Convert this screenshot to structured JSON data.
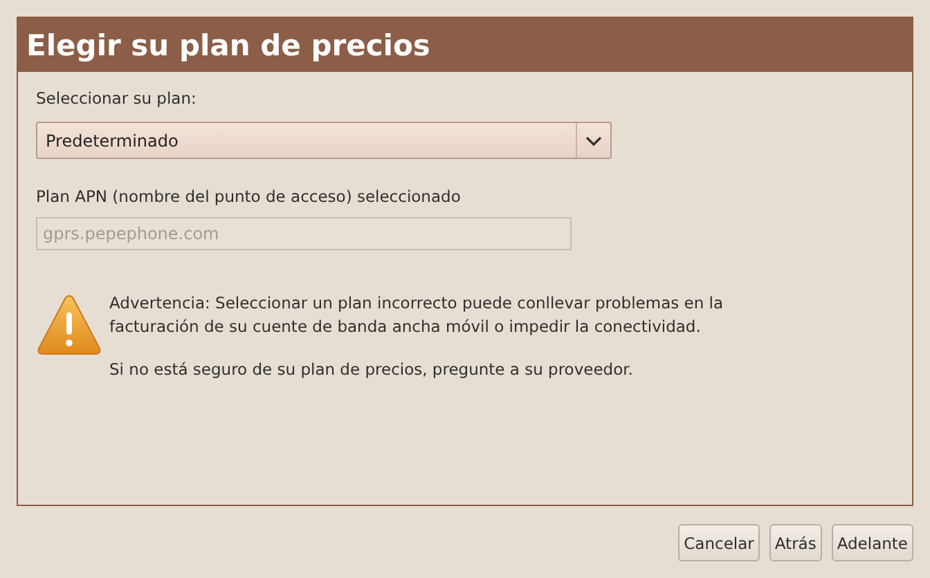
{
  "title": "Elegir su plan de precios",
  "plan": {
    "label": "Seleccionar su plan:",
    "value": "Predeterminado"
  },
  "apn": {
    "label": "Plan APN (nombre del punto de acceso) seleccionado",
    "placeholder": "gprs.pepephone.com",
    "disabled": true
  },
  "warning": [
    "Advertencia: Seleccionar un plan incorrecto puede conllevar problemas en la facturación de su cuente de banda ancha móvil o impedir la conectividad.",
    "Si no está seguro de su plan de precios, pregunte a su proveedor."
  ],
  "buttons": [
    "Cancelar",
    "Atrás",
    "Adelante"
  ]
}
